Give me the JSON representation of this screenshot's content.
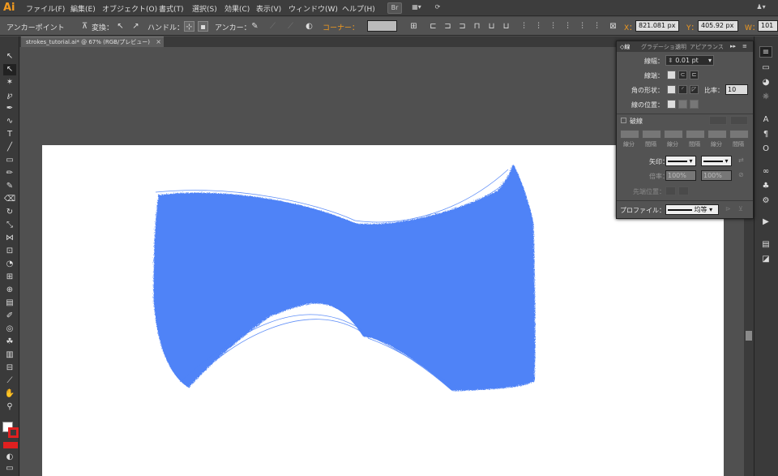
{
  "app": {
    "logo": "Ai"
  },
  "menu": [
    "ファイル(F)",
    "編集(E)",
    "オブジェクト(O)",
    "書式(T)",
    "選択(S)",
    "効果(C)",
    "表示(V)",
    "ウィンドウ(W)",
    "ヘルプ(H)"
  ],
  "menu_buttons": {
    "br": "Br",
    "arrange": "▦▾",
    "sync": "⟳"
  },
  "control": {
    "mode": "アンカーポイント",
    "convert": "変換：",
    "handle": "ハンドル：",
    "anchor": "アンカー：",
    "corner": "コーナー：",
    "x_label": "X：",
    "x_value": "821.081 px",
    "y_label": "Y：",
    "y_value": "405.92 px",
    "w_label": "W：",
    "w_value": "101"
  },
  "document": {
    "tab": "strokes_tutorial.ai* @ 67% (RGB/プレビュー)",
    "close": "×"
  },
  "art": {
    "fill": "#4f83f7"
  },
  "stroke_panel": {
    "tabs": [
      "◇線",
      "グラデーション",
      "透明",
      "アピアランス"
    ],
    "weight_label": "線幅：",
    "weight_value": "0.01 pt",
    "cap_label": "線端：",
    "corner_label": "角の形状：",
    "ratio_label": "比率：",
    "ratio_value": "10",
    "align_label": "線の位置：",
    "dashed_label": "破線",
    "dash_labels": [
      "線分",
      "間隔",
      "線分",
      "間隔",
      "線分",
      "間隔"
    ],
    "arrow_label": "矢印：",
    "scale_label": "倍率：",
    "scale_1": "100%",
    "scale_2": "100%",
    "arrow_pos_label": "先端位置：",
    "profile_label": "プロファイル：",
    "profile_value": "均等"
  }
}
